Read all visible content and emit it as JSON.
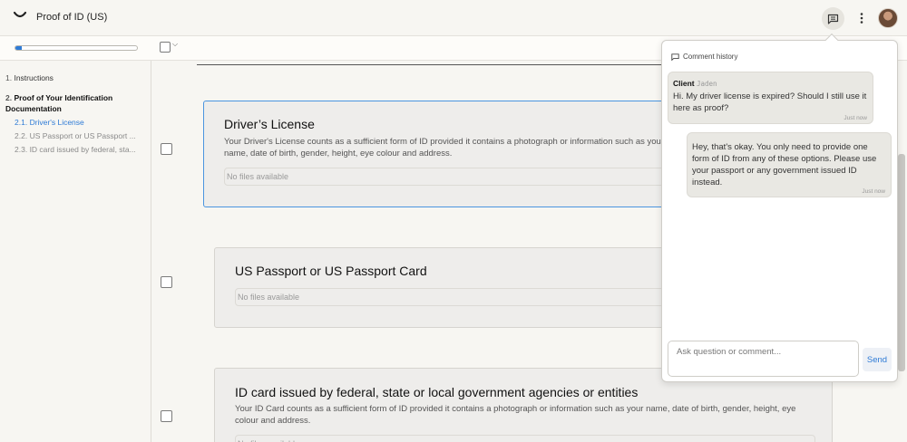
{
  "header": {
    "title": "Proof of ID (US)"
  },
  "toolbar": {
    "progress": 0.05
  },
  "sidebar": {
    "items": [
      {
        "num": "1.",
        "label": "Instructions"
      },
      {
        "num": "2.",
        "label": "Proof of Your Identification Documentation"
      }
    ],
    "subitems": [
      {
        "num": "2.1.",
        "label": "Driver's License"
      },
      {
        "num": "2.2.",
        "label": "US Passport or US Passport ..."
      },
      {
        "num": "2.3.",
        "label": "ID card issued by federal, sta..."
      }
    ]
  },
  "main": {
    "cards": [
      {
        "title": "Driver’s License",
        "desc": "Your Driver's License counts as a sufficient form of ID provided it contains a photograph or information such as your name, date of birth, gender, height, eye colour and address.",
        "files": "No files available"
      },
      {
        "title": "US Passport or US Passport Card",
        "files": "No files available"
      },
      {
        "title": "ID card issued by federal, state or local government agencies or entities",
        "desc": "Your ID Card counts as a sufficient form of ID provided it contains a photograph or information such as your name, date of birth, gender, height, eye colour and address.",
        "files": "No files available"
      }
    ]
  },
  "comments": {
    "title": "Comment history",
    "messages": [
      {
        "role": "Client",
        "author": "Jaden",
        "text": "Hi. My driver license is expired? Should I still use it here as proof?",
        "time": "Just now"
      },
      {
        "text": "Hey, that's okay. You only need to provide one form of ID from any of these options. Please use your passport or any government issued ID instead.",
        "time": "Just now"
      }
    ],
    "placeholder": "Ask question or comment...",
    "send_label": "Send"
  },
  "colors": {
    "accent": "#2e7bd6",
    "active_border": "#4a95e0"
  }
}
